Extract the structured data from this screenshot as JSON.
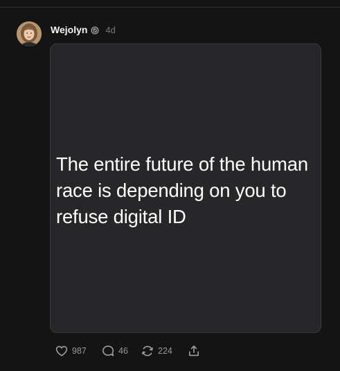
{
  "post": {
    "author": "Wejolyn",
    "time": "4d",
    "card_text": "The entire future of the human race is depending on you to refuse digital ID"
  },
  "actions": {
    "likes": "987",
    "replies": "46",
    "reposts": "224"
  },
  "icons": {
    "verified": "verified-badge-icon",
    "like": "heart-icon",
    "reply": "comment-icon",
    "repost": "repost-icon",
    "share": "share-icon"
  },
  "colors": {
    "background": "#141414",
    "card": "#27272a",
    "text": "#f3f5f7",
    "muted": "#777777"
  }
}
